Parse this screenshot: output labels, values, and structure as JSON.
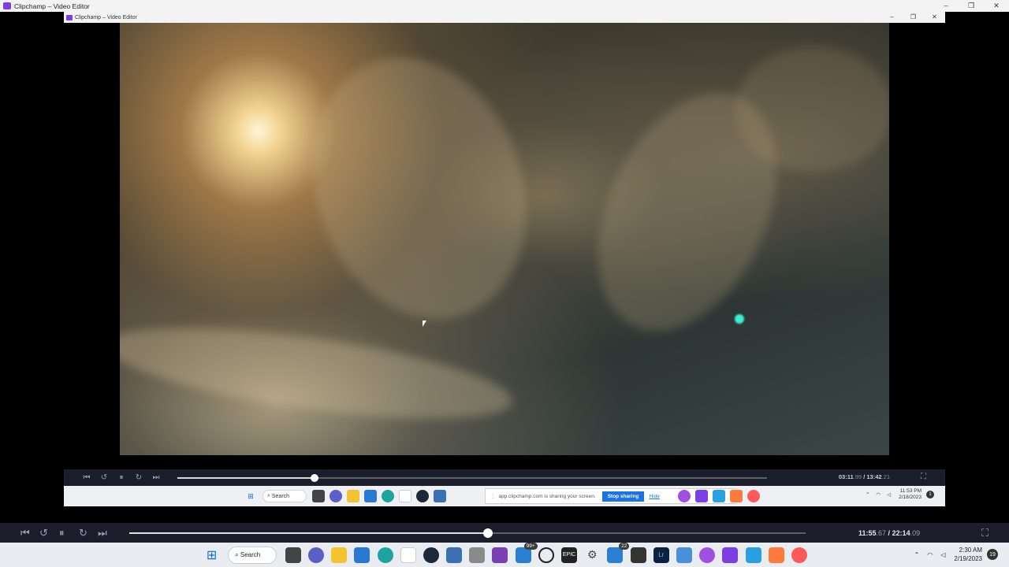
{
  "outer_window": {
    "title": "Clipchamp – Video Editor",
    "controls": [
      "–",
      "❐",
      "✕"
    ]
  },
  "inner_window": {
    "title": "Clipchamp – Video Editor",
    "controls": [
      "–",
      "❐",
      "✕"
    ]
  },
  "inner_player": {
    "buttons": [
      "⏮",
      "↺",
      "⏸",
      "↻",
      "⏭"
    ],
    "progress": 0.233,
    "time_current": "03:11",
    "time_current_frac": ".99",
    "time_sep": " / ",
    "time_total": "13:42",
    "time_total_frac": ".21",
    "fullscreen_icon": "⛶"
  },
  "inner_taskbar": {
    "search_label": "Search",
    "share_message": "app.clipchamp.com is sharing your screen.",
    "stop_label": "Stop sharing",
    "hide_label": "Hide",
    "clock_time": "11:53 PM",
    "clock_date": "2/18/2023",
    "notif_count": "1"
  },
  "outer_player": {
    "buttons": [
      "⏮",
      "↺",
      "⏸",
      "↻",
      "⏭"
    ],
    "progress": 0.53,
    "time_current": "11:55",
    "time_current_frac": ".67",
    "time_sep": " / ",
    "time_total": "22:14",
    "time_total_frac": ".09",
    "fullscreen_icon": "⛶"
  },
  "outer_taskbar": {
    "search_label": "Search",
    "badge_mail": "99+",
    "badge_teams": "22",
    "clock_time": "2:30 AM",
    "clock_date": "2/19/2023",
    "notif_count": "19"
  },
  "colors": {
    "accent": "#1a73e8",
    "player_bg": "#1b1e2a",
    "clipchamp": "#7b3fe4",
    "highlight_dot": "#3ef0d3"
  }
}
